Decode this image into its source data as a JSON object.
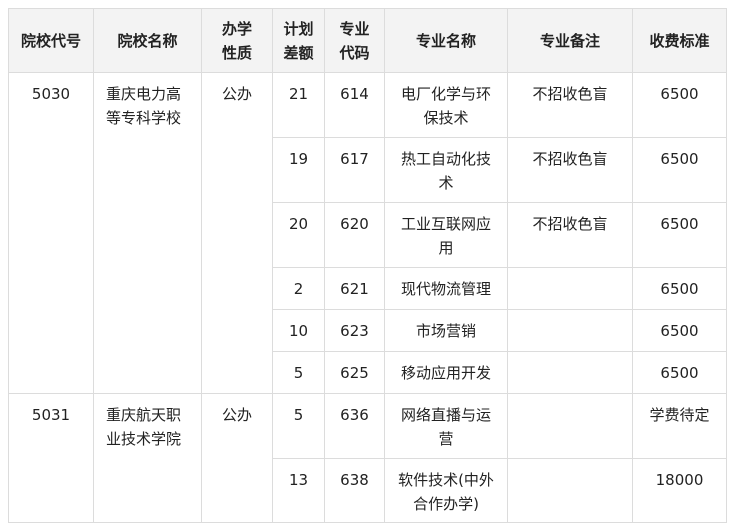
{
  "table": {
    "headers": [
      "院校代号",
      "院校名称",
      "办学性质",
      "计划差额",
      "专业代码",
      "专业名称",
      "专业备注",
      "收费标准"
    ],
    "schools": [
      {
        "code": "5030",
        "name": "重庆电力高等专科学校",
        "nature": "公办",
        "majors": [
          {
            "quota": "21",
            "code": "614",
            "name": "电厂化学与环保技术",
            "note": "不招收色盲",
            "fee": "6500"
          },
          {
            "quota": "19",
            "code": "617",
            "name": "热工自动化技术",
            "note": "不招收色盲",
            "fee": "6500"
          },
          {
            "quota": "20",
            "code": "620",
            "name": "工业互联网应用",
            "note": "不招收色盲",
            "fee": "6500"
          },
          {
            "quota": "2",
            "code": "621",
            "name": "现代物流管理",
            "note": "",
            "fee": "6500"
          },
          {
            "quota": "10",
            "code": "623",
            "name": "市场营销",
            "note": "",
            "fee": "6500"
          },
          {
            "quota": "5",
            "code": "625",
            "name": "移动应用开发",
            "note": "",
            "fee": "6500"
          }
        ]
      },
      {
        "code": "5031",
        "name": "重庆航天职业技术学院",
        "nature": "公办",
        "majors": [
          {
            "quota": "5",
            "code": "636",
            "name": "网络直播与运营",
            "note": "",
            "fee": "学费待定"
          },
          {
            "quota": "13",
            "code": "638",
            "name": "软件技术(中外合作办学)",
            "note": "",
            "fee": "18000"
          }
        ]
      }
    ]
  }
}
